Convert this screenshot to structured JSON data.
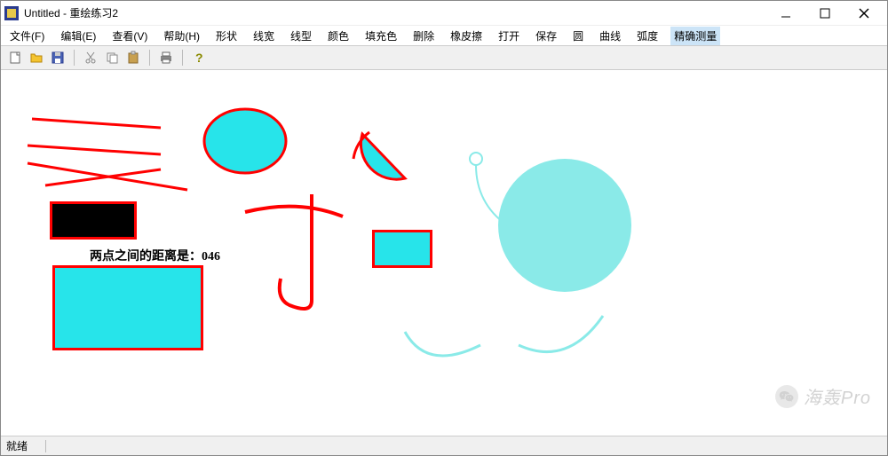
{
  "window": {
    "title": "Untitled - 重绘练习2"
  },
  "menu": {
    "items": [
      "文件(F)",
      "编辑(E)",
      "查看(V)",
      "帮助(H)",
      "形状",
      "线宽",
      "线型",
      "颜色",
      "填充色",
      "删除",
      "橡皮擦",
      "打开",
      "保存",
      "圆",
      "曲线",
      "弧度",
      "精确测量"
    ],
    "highlighted_index": 16
  },
  "toolbar": {
    "buttons": [
      "new",
      "open",
      "save",
      "cut",
      "copy",
      "paste",
      "print",
      "help"
    ]
  },
  "canvas": {
    "distance_label": "两点之间的距离是：046"
  },
  "statusbar": {
    "text": "就绪"
  },
  "watermark": {
    "text": "海轰Pro"
  }
}
